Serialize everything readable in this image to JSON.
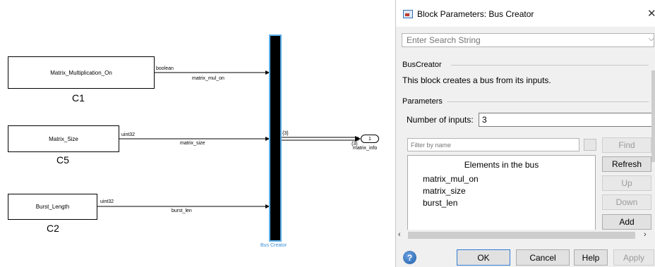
{
  "canvas": {
    "blocks": [
      {
        "label": "Matrix_Multiplication_On",
        "caption": "C1",
        "out_type": "boolean",
        "signal": "matrix_mul_on"
      },
      {
        "label": "Matrix_Size",
        "caption": "C5",
        "out_type": "uint32",
        "signal": "matrix_size"
      },
      {
        "label": "Burst_Length",
        "caption": "C2",
        "out_type": "uint32",
        "signal": "burst_len"
      }
    ],
    "bus_creator_label": "Bus Creator",
    "bus_width_label": "{3}",
    "bus_out_label": "{3}",
    "outport_number": "1",
    "outport_signal": "matrix_info"
  },
  "dialog": {
    "title": "Block Parameters: Bus Creator",
    "search_placeholder": "Enter Search String",
    "section_name": "BusCreator",
    "description": "This block creates a bus from its inputs.",
    "parameters_label": "Parameters",
    "num_inputs_label": "Number of inputs:",
    "num_inputs_value": "3",
    "filter_placeholder": "Filter by name",
    "side_buttons": {
      "find": "Find",
      "refresh": "Refresh",
      "up": "Up",
      "down": "Down",
      "add": "Add"
    },
    "list_header": "Elements in the bus",
    "elements": [
      "matrix_mul_on",
      "matrix_size",
      "burst_len"
    ],
    "footer": {
      "ok": "OK",
      "cancel": "Cancel",
      "help": "Help",
      "apply": "Apply"
    }
  },
  "colors": {
    "selection_outline": "#5aaee8",
    "bus_label": "#3d8fd6",
    "ok_border": "#2f7bd6"
  }
}
